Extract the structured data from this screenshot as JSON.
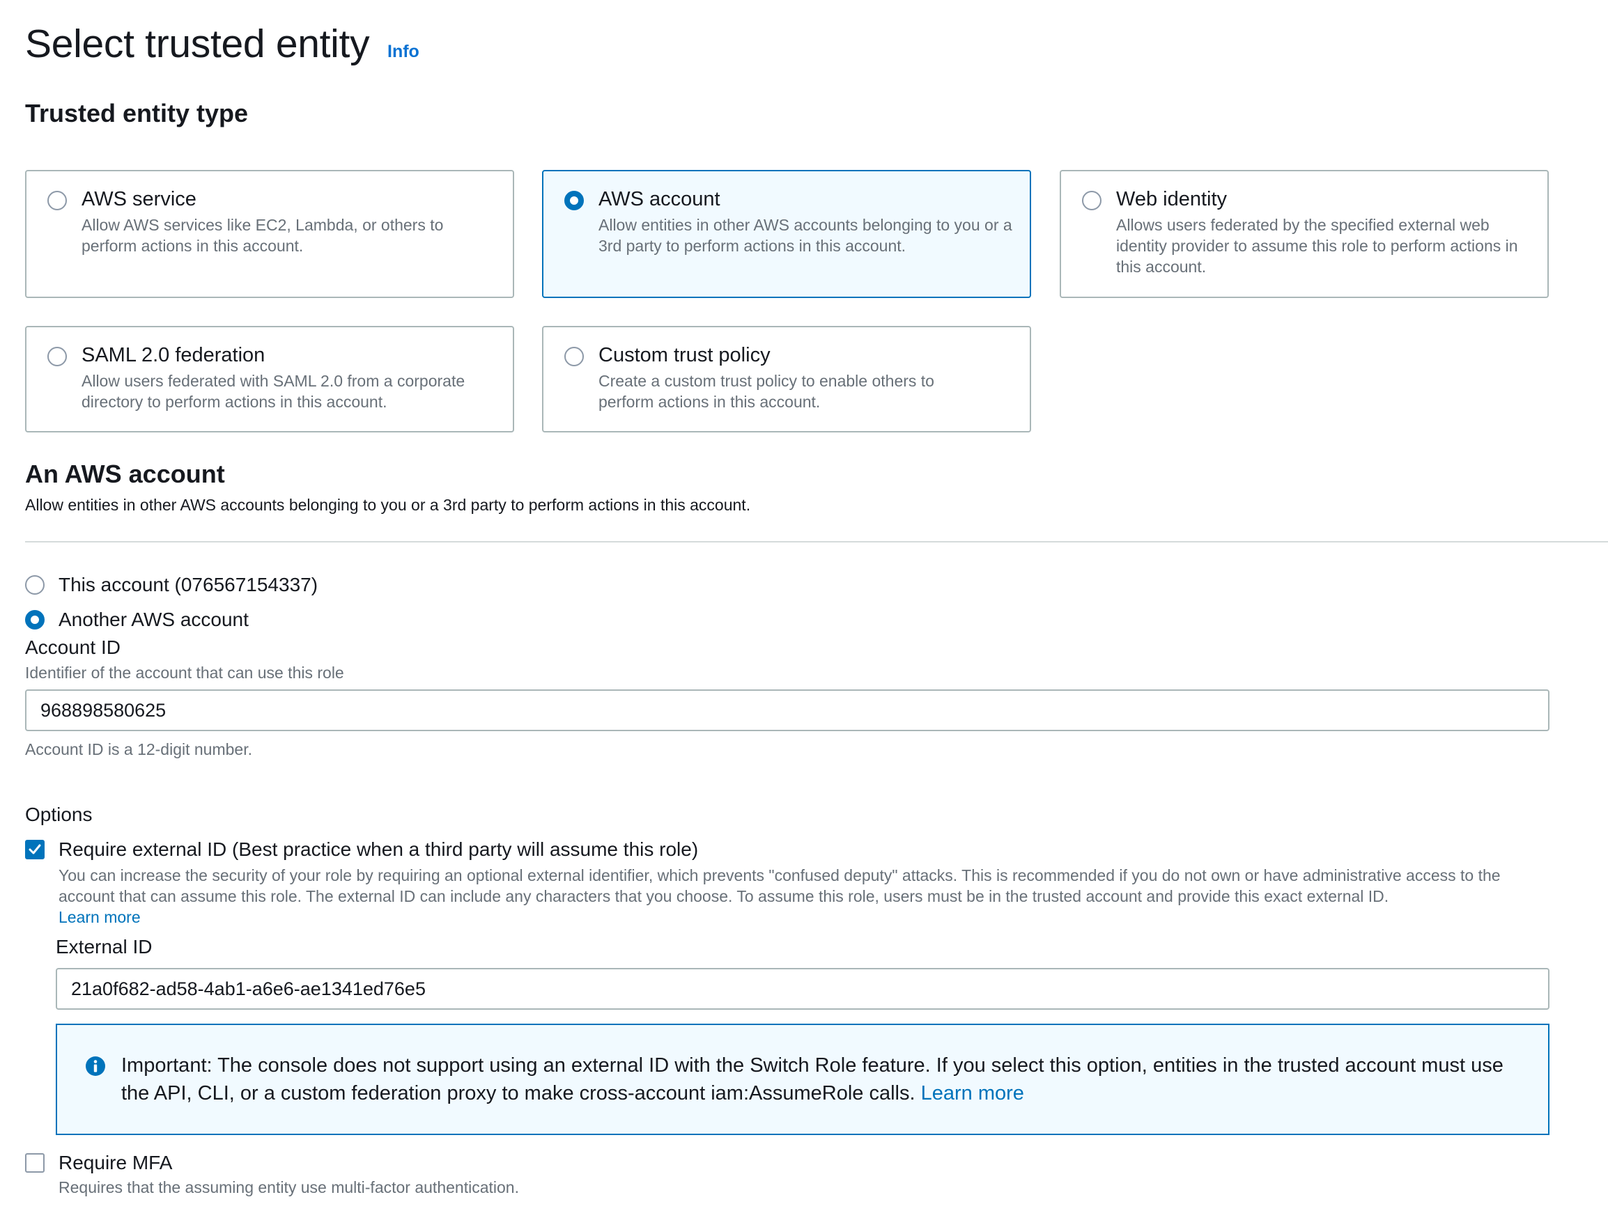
{
  "header": {
    "title": "Select trusted entity",
    "info_link": "Info"
  },
  "entity_type": {
    "heading": "Trusted entity type",
    "selected": "AWS account",
    "tiles": [
      {
        "title": "AWS service",
        "description": "Allow AWS services like EC2, Lambda, or others to perform actions in this account."
      },
      {
        "title": "AWS account",
        "description": "Allow entities in other AWS accounts belonging to you or a 3rd party to perform actions in this account."
      },
      {
        "title": "Web identity",
        "description": "Allows users federated by the specified external web identity provider to assume this role to perform actions in this account."
      },
      {
        "title": "SAML 2.0 federation",
        "description": "Allow users federated with SAML 2.0 from a corporate directory to perform actions in this account."
      },
      {
        "title": "Custom trust policy",
        "description": "Create a custom trust policy to enable others to perform actions in this account."
      }
    ]
  },
  "aws_account": {
    "heading": "An AWS account",
    "description": "Allow entities in other AWS accounts belonging to you or a 3rd party to perform actions in this account.",
    "options": [
      {
        "label": "This account (076567154337)",
        "selected": false
      },
      {
        "label": "Another AWS account",
        "selected": true
      }
    ],
    "account_id": {
      "label": "Account ID",
      "description": "Identifier of the account that can use this role",
      "value": "968898580625",
      "constraint": "Account ID is a 12-digit number."
    }
  },
  "options": {
    "heading": "Options",
    "external_id_checkbox": {
      "label": "Require external ID (Best practice when a third party will assume this role)",
      "checked": true,
      "description": "You can increase the security of your role by requiring an optional external identifier, which prevents \"confused deputy\" attacks. This is recommended if you do not own or have administrative access to the account that can assume this role. The external ID can include any characters that you choose. To assume this role, users must be in the trusted account and provide this exact external ID.",
      "learn_more": "Learn more"
    },
    "external_id": {
      "label": "External ID",
      "value": "21a0f682-ad58-4ab1-a6e6-ae1341ed76e5"
    },
    "alert": {
      "text": "Important: The console does not support using an external ID with the Switch Role feature. If you select this option, entities in the trusted account must use the API, CLI, or a custom federation proxy to make cross-account iam:AssumeRole calls.",
      "learn_more": "Learn more"
    },
    "mfa_checkbox": {
      "label": "Require MFA",
      "checked": false,
      "description": "Requires that the assuming entity use multi-factor authentication."
    }
  },
  "colors": {
    "accent": "#0073bb",
    "link": "#0972d3",
    "selected_bg": "#f1faff",
    "muted_text": "#687078",
    "border": "#aab7b8"
  }
}
